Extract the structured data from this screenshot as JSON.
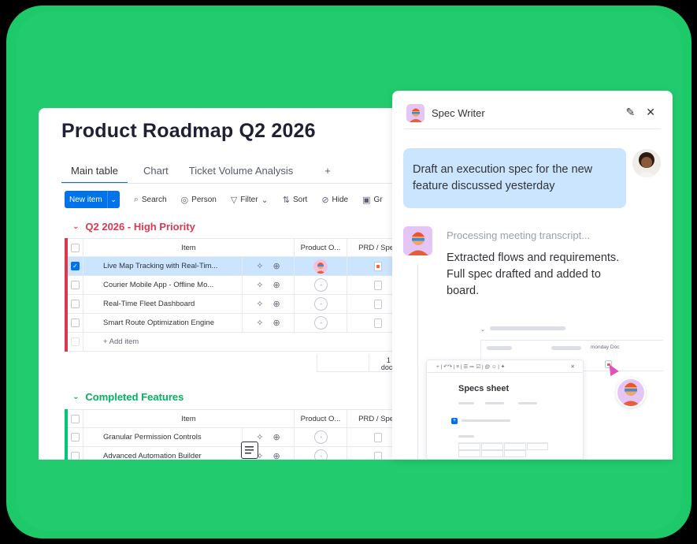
{
  "board": {
    "title": "Product Roadmap Q2 2026",
    "tabs": [
      "Main table",
      "Chart",
      "Ticket Volume Analysis",
      "+"
    ],
    "toolbar": {
      "new_item": "New item",
      "search": "Search",
      "person": "Person",
      "filter": "Filter",
      "sort": "Sort",
      "hide": "Hide",
      "group": "Gr"
    },
    "columns": {
      "item": "Item",
      "owner": "Product O...",
      "prd": "PRD / Spec"
    },
    "groups": [
      {
        "name": "Q2 2026 - High Priority",
        "color": "#d83a52",
        "rows": [
          "Live Map Tracking with Real-Tim...",
          "Courier Mobile App - Offline Mo...",
          "Real-Time Fleet Dashboard",
          "Smart Route Optimization Engine"
        ],
        "add_item": "+ Add item",
        "summary_count": "1",
        "summary_unit": "docs"
      },
      {
        "name": "Completed Features",
        "color": "#00c875",
        "rows": [
          "Granular Permission Controls",
          "Advanced Automation Builder"
        ]
      }
    ]
  },
  "chat": {
    "title": "Spec Writer",
    "user_message": "Draft an execution spec for the new feature discussed yesterday",
    "processing": "Processing meeting transcript...",
    "reply": "Extracted flows and requirements. Full spec drafted and added to board.",
    "mini_board": {
      "doc_col": "monday Doc"
    },
    "sheet": {
      "title": "Specs sheet",
      "toolbar": "+ | ↶↷ | ≡ | ☰ ≔ ☑ | @ ☺ | ✦",
      "close": "✕"
    }
  },
  "colors": {
    "background": "#22cc6e",
    "accent": "#0073ea",
    "selected_row": "#cce5ff"
  }
}
